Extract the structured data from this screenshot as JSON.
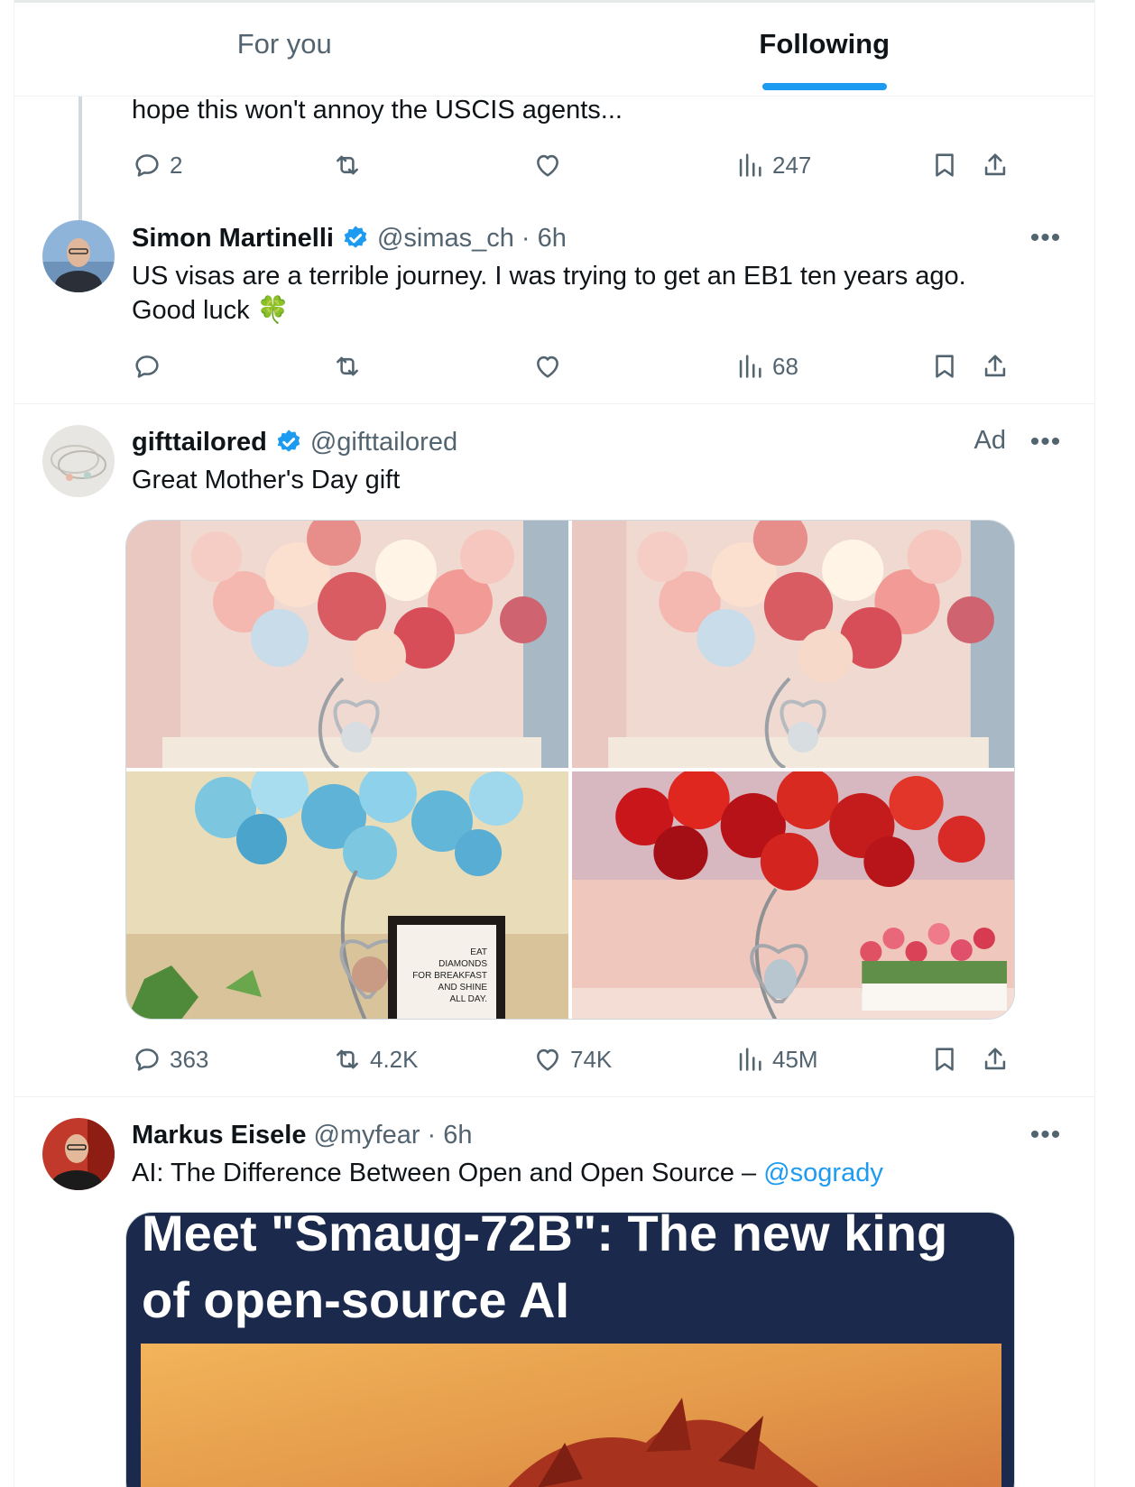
{
  "tabs": [
    {
      "label": "For you"
    },
    {
      "label": "Following"
    }
  ],
  "previous_post": {
    "text": "hope this won't annoy the USCIS agents...",
    "replies": "2",
    "reposts": "",
    "likes": "",
    "views": "247"
  },
  "reply_post": {
    "name": "Simon Martinelli",
    "handle": "@simas_ch",
    "time": "· 6h",
    "text_line1": "US visas are a terrible journey. I was trying to get an EB1 ten years ago.",
    "text_line2": "Good luck 🍀",
    "replies": "",
    "reposts": "",
    "likes": "",
    "views": "68"
  },
  "ad_post": {
    "name": "gifttailored",
    "handle": "@gifttailored",
    "ad_label": "Ad",
    "text": "Great Mother's Day gift",
    "images": [
      {
        "label": "pink and white rose lamp"
      },
      {
        "label": "pink and white rose lamp"
      },
      {
        "label": "blue rose lamp",
        "sign_lines": [
          "EAT",
          "DIAMONDS",
          "FOR BREAKFAST",
          "AND SHINE",
          "ALL DAY."
        ]
      },
      {
        "label": "red rose lamp"
      }
    ],
    "replies": "363",
    "reposts": "4.2K",
    "likes": "74K",
    "views": "45M"
  },
  "markus_post": {
    "name": "Markus Eisele",
    "handle": "@myfear",
    "time": "· 6h",
    "text": "AI: The Difference Between Open and Open Source – ",
    "mention": "@sogrady",
    "card_title_line1": "Meet \"Smaug-72B\": The new king",
    "card_title_line2": "of open-source AI"
  },
  "icons": {
    "reply": "reply-icon",
    "repost": "repost-icon",
    "like": "heart-icon",
    "views": "views-icon",
    "bookmark": "bookmark-icon",
    "share": "share-icon",
    "verified": "verified-badge-icon",
    "more": "more-icon"
  },
  "colors": {
    "accent": "#1d9bf0",
    "secondary_text": "#536471",
    "primary_text": "#0f1419",
    "card_bg": "#1b2a4c"
  }
}
